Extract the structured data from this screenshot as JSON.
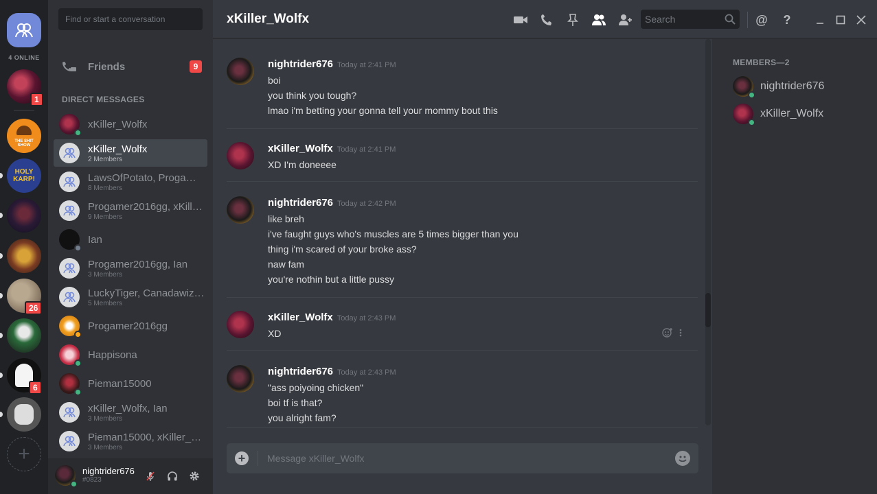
{
  "rail": {
    "online_label": "4 ONLINE",
    "servers": [
      {
        "name": "server-1",
        "badge": "1"
      },
      {
        "name": "the-shit-show",
        "text": "THE SHIT SHOW"
      },
      {
        "name": "holy-karp",
        "text": "HOLY KARP!"
      },
      {
        "name": "server-blood"
      },
      {
        "name": "league-of-legends"
      },
      {
        "name": "server-moon",
        "badge": "26"
      },
      {
        "name": "server-joker"
      },
      {
        "name": "server-ghost",
        "badge": "6"
      },
      {
        "name": "server-owl"
      }
    ],
    "add_symbol": "+"
  },
  "dm_sidebar": {
    "search_placeholder": "Find or start a conversation",
    "friends_label": "Friends",
    "friends_badge": "9",
    "section_title": "DIRECT MESSAGES",
    "items": [
      {
        "name": "xKiller_Wolfx",
        "sub": "",
        "status": "online",
        "type": "user"
      },
      {
        "name": "xKiller_Wolfx",
        "sub": "2 Members",
        "status": "",
        "type": "group",
        "active": true
      },
      {
        "name": "LawsOfPotato, Progamer2016gg, …",
        "sub": "8 Members",
        "status": "",
        "type": "group"
      },
      {
        "name": "Progamer2016gg, xKiller_Wolfx, …",
        "sub": "9 Members",
        "status": "",
        "type": "group"
      },
      {
        "name": "Ian",
        "sub": "",
        "status": "offline",
        "type": "user"
      },
      {
        "name": "Progamer2016gg, Ian",
        "sub": "3 Members",
        "status": "",
        "type": "group"
      },
      {
        "name": "LuckyTiger, Canadawizard, …",
        "sub": "5 Members",
        "status": "",
        "type": "group"
      },
      {
        "name": "Progamer2016gg",
        "sub": "",
        "status": "idle",
        "type": "user"
      },
      {
        "name": "Happisona",
        "sub": "",
        "status": "online",
        "type": "user"
      },
      {
        "name": "Pieman15000",
        "sub": "",
        "status": "online",
        "type": "user"
      },
      {
        "name": "xKiller_Wolfx, Ian",
        "sub": "3 Members",
        "status": "",
        "type": "group"
      },
      {
        "name": "Pieman15000, xKiller_Wolfx, …",
        "sub": "3 Members",
        "status": "",
        "type": "group"
      }
    ]
  },
  "user_panel": {
    "username": "nightrider676",
    "tag": "#0823"
  },
  "header": {
    "title": "xKiller_Wolfx",
    "search_placeholder": "Search",
    "help_symbol": "?",
    "mention_symbol": "@"
  },
  "messages": [
    {
      "author": "nightrider676",
      "time": "Today at 2:41 PM",
      "avatar": "night",
      "lines": [
        "boi",
        "you think you tough?",
        "lmao i'm betting your gonna tell your mommy bout this"
      ]
    },
    {
      "author": "xKiller_Wolfx",
      "time": "Today at 2:41 PM",
      "avatar": "wolf",
      "lines": [
        "XD I'm doneeee"
      ]
    },
    {
      "author": "nightrider676",
      "time": "Today at 2:42 PM",
      "avatar": "night",
      "lines": [
        "like breh",
        "i've faught guys who's muscles are 5 times bigger than you",
        "thing i'm scared of your broke ass?",
        "naw fam",
        "you're nothin but a little pussy"
      ]
    },
    {
      "author": "xKiller_Wolfx",
      "time": "Today at 2:43 PM",
      "avatar": "wolf",
      "lines": [
        "XD"
      ]
    },
    {
      "author": "nightrider676",
      "time": "Today at 2:43 PM",
      "avatar": "night",
      "lines": [
        "\"ass poiyoing chicken\"",
        "boi tf is that?",
        "you alright fam?"
      ]
    }
  ],
  "composer": {
    "placeholder": "Message xKiller_Wolfx"
  },
  "members": {
    "title": "MEMBERS—2",
    "list": [
      {
        "name": "nightrider676",
        "status": "online",
        "avatar": "night"
      },
      {
        "name": "xKiller_Wolfx",
        "status": "online",
        "avatar": "wolf"
      }
    ]
  },
  "colors": {
    "accent": "#7289da",
    "online": "#43b581",
    "idle": "#faa61a",
    "offline": "#747f8d",
    "badge": "#f04747"
  }
}
